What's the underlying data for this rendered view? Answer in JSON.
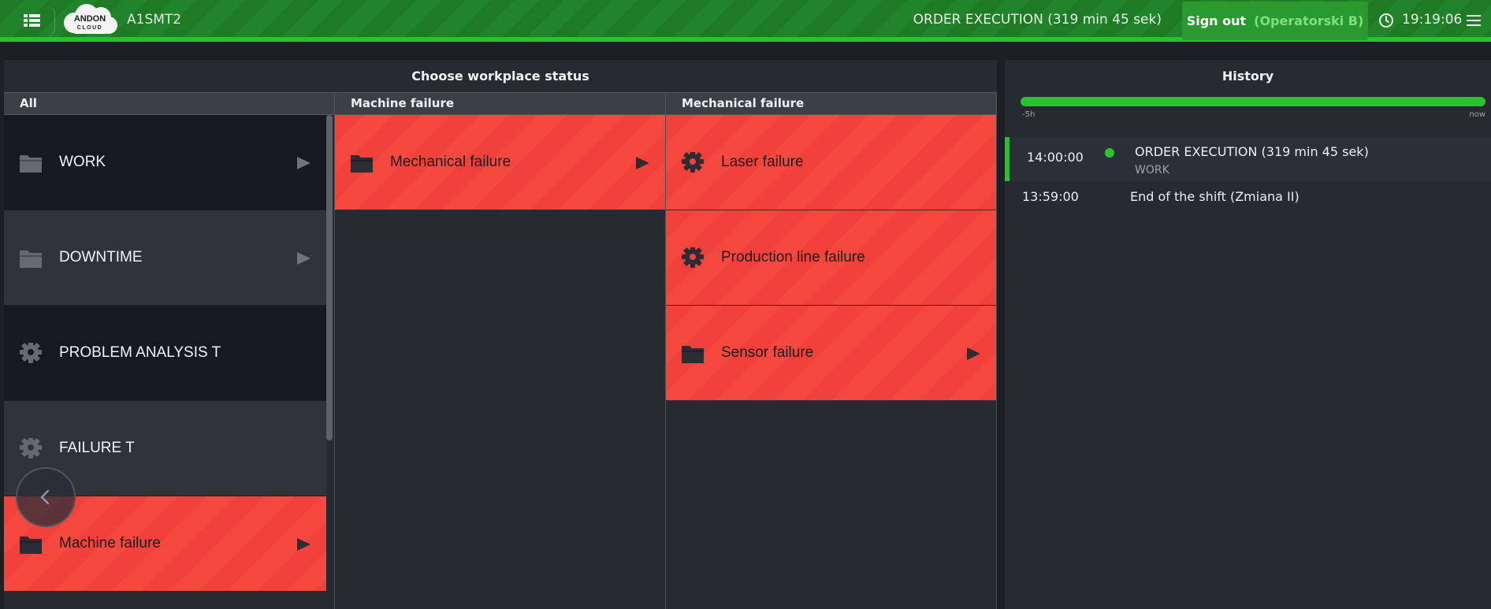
{
  "topbar": {
    "workstation": "A1SMT2",
    "logo_text_top": "ANDON",
    "logo_text_bottom": "CLOUD",
    "order_status": "ORDER EXECUTION  (319 min 45 sek)",
    "signout_label": "Sign out",
    "signout_user": "(Operatorski B)",
    "clock_time": "19:19:06"
  },
  "status_panel": {
    "title": "Choose workplace status",
    "columns": [
      {
        "header": "All",
        "tiles": [
          {
            "label": "WORK",
            "icon": "folder-icon",
            "arrow": true,
            "style": "dark-a"
          },
          {
            "label": "DOWNTIME",
            "icon": "folder-icon",
            "arrow": true,
            "style": "dark-b"
          },
          {
            "label": "PROBLEM ANALYSIS T",
            "icon": "gear-icon",
            "arrow": false,
            "style": "dark-a"
          },
          {
            "label": "FAILURE T",
            "icon": "gear-icon",
            "arrow": false,
            "style": "dark-b"
          },
          {
            "label": "Machine failure",
            "icon": "folder-icon",
            "arrow": true,
            "style": "red"
          }
        ]
      },
      {
        "header": "Machine failure",
        "tiles": [
          {
            "label": "Mechanical failure",
            "icon": "folder-icon",
            "arrow": true,
            "style": "red"
          }
        ]
      },
      {
        "header": "Mechanical failure",
        "tiles": [
          {
            "label": "Laser failure",
            "icon": "gear-icon",
            "arrow": false,
            "style": "red"
          },
          {
            "label": "Production line failure",
            "icon": "gear-icon",
            "arrow": false,
            "style": "red"
          },
          {
            "label": "Sensor failure",
            "icon": "folder-icon",
            "arrow": true,
            "style": "red"
          }
        ]
      }
    ]
  },
  "history": {
    "title": "History",
    "timeline_start": "-5h",
    "timeline_end": "now",
    "entries": [
      {
        "time": "14:00:00",
        "title": "ORDER EXECUTION (319 min 45 sek)",
        "subtitle": "WORK",
        "active": true
      },
      {
        "time": "13:59:00",
        "title": "End of the shift (Zmiana II)",
        "subtitle": "",
        "active": false
      }
    ]
  },
  "colors": {
    "topbar_green": "#1f7a24",
    "accent_green": "#27c32e",
    "tile_red": "#f2413a",
    "panel_bg": "#262a31"
  }
}
